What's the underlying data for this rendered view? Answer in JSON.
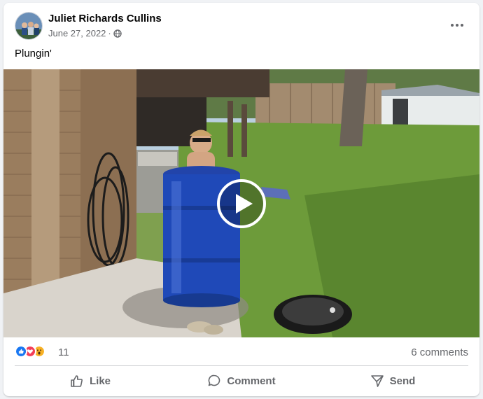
{
  "post": {
    "author": "Juliet Richards Cullins",
    "date": "June 27, 2022",
    "separator": "·",
    "audience_icon": "globe-icon",
    "more_icon": "more-options-icon",
    "caption": "Plungin'"
  },
  "media": {
    "type": "video",
    "play_icon": "play-icon"
  },
  "engagement": {
    "reactions": [
      "like",
      "love",
      "wow"
    ],
    "reaction_count": "11",
    "comments": "6 comments"
  },
  "actions": {
    "like": "Like",
    "comment": "Comment",
    "send": "Send"
  },
  "colors": {
    "like_blue": "#1877f2",
    "love_red": "#f33e58",
    "wow_yellow": "#f7b125",
    "secondary_text": "#65676b"
  }
}
